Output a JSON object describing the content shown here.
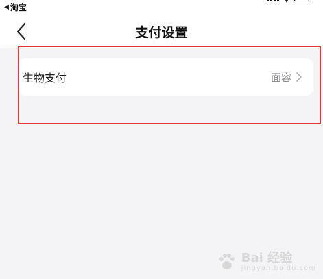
{
  "status_bar": {
    "back_app_label": "淘宝",
    "back_arrow_icon": "left-triangle-icon",
    "signal_icon": "signal-bars-icon",
    "wifi_icon": "wifi-icon",
    "battery_icon": "battery-icon"
  },
  "nav": {
    "back_icon": "chevron-left-icon",
    "title": "支付设置"
  },
  "settings": {
    "rows": [
      {
        "label": "生物支付",
        "value": "面容",
        "icon": "chevron-right-icon"
      }
    ]
  },
  "watermark": {
    "text": "Bai 经验",
    "sub": "jingyan.baidu.com"
  },
  "colors": {
    "highlight_border": "#e53935",
    "background": "#f4f4f6",
    "value_text": "#8e8e93"
  }
}
